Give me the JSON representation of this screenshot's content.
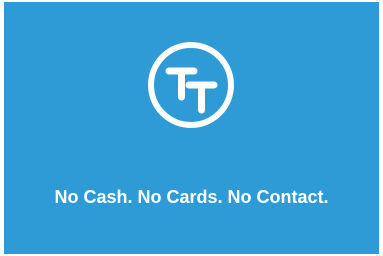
{
  "colors": {
    "background": "#2f9bd6",
    "foreground": "#ffffff"
  },
  "logo": {
    "icon": "tt-monogram-icon"
  },
  "tagline": "No Cash. No Cards. No Contact."
}
